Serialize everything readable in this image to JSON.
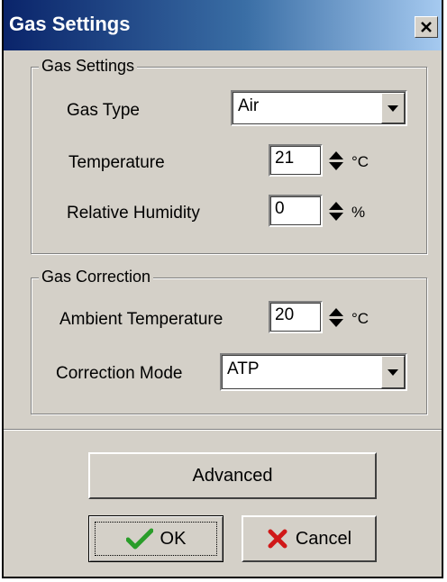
{
  "window": {
    "title": "Gas Settings"
  },
  "gas_settings": {
    "legend": "Gas Settings",
    "gas_type": {
      "label": "Gas Type",
      "value": "Air"
    },
    "temperature": {
      "label": "Temperature",
      "value": "21",
      "unit": "°C"
    },
    "relative_humidity": {
      "label": "Relative Humidity",
      "value": "0",
      "unit": "%"
    }
  },
  "gas_correction": {
    "legend": "Gas Correction",
    "ambient_temperature": {
      "label": "Ambient Temperature",
      "value": "20",
      "unit": "°C"
    },
    "correction_mode": {
      "label": "Correction Mode",
      "value": "ATP"
    }
  },
  "buttons": {
    "advanced": "Advanced",
    "ok": "OK",
    "cancel": "Cancel"
  },
  "colors": {
    "ok_icon": "#2a9d2a",
    "cancel_icon": "#d01818",
    "face": "#d4d0c8",
    "title_start": "#0a246a"
  }
}
